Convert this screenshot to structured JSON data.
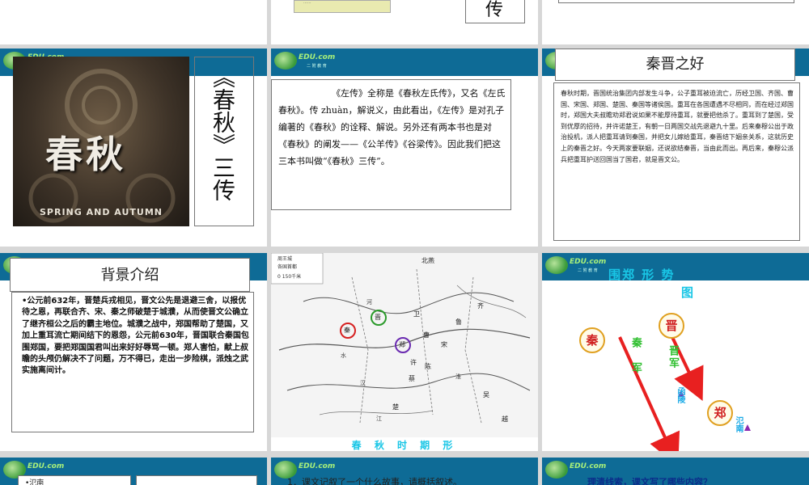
{
  "logo": {
    "text": "EDU.com",
    "sub": "二 附 教 育"
  },
  "row0": {
    "s2_char": "传"
  },
  "s4": {
    "image_title": "春秋",
    "image_subtitle": "SPRING AND AUTUMN",
    "vertical_title": "《春秋》三传"
  },
  "s5": {
    "text": "《左传》全称是《春秋左氏传》，又名《左氏春秋》。传 zhuàn，解说义，由此看出，《左传》是对孔子编著的《春秋》的诠释、解说。另外还有两本书也是对《春秋》的阐发——《公羊传》《谷梁传》。因此我们把这三本书叫做“《春秋》三传”。"
  },
  "s6": {
    "title": "秦晋之好",
    "text": "春秋时期，晋国统治集团内部发生斗争，公子重耳被迫流亡，历经卫国、齐国、曹国、宋国、郑国、楚国、秦国等诸侯国。重耳在各国遭遇不尽相同，而在经过郑国时，郑国大夫叔瞻劝郑君说如果不能厚待重耳，就要把他杀了。重耳到了楚国，受到优厚的招待，并许诺楚王，有朝一日两国交战先退避九十里。后来秦穆公出于政治投机，派人把重耳请到秦国，并把女儿嫁给重耳，秦晋结下姻亲关系，这就历史上的秦晋之好。今天两家要联姻，还说欲结秦晋，当由此而出。再后来，秦穆公派兵把重耳护送回国当了国君，就是晋文公。"
  },
  "s7": {
    "title": "背景介绍",
    "text": "•公元前632年，晋楚兵戎相见，晋文公先是退避三舍，以报优待之恩，再联合齐、宋、秦之师破楚于城濮，从而使晋文公确立了继齐桓公之后的霸主地位。城濮之战中，郑国帮助了楚国，又加上重耳流亡期间结下的恩怨，公元前630年，晋国联合秦国包围郑国，要把郑国国君叫出来好好辱骂一顿。郑人害怕，献上叔瞻的头颅仍解决不了问题，万不得已，走出一步险棋，派烛之武实施离间计。"
  },
  "s8": {
    "legend": [
      "周王城",
      "各国首都"
    ],
    "scale": "0 150千米",
    "caption": "春 秋 时 期 形",
    "states": [
      "北燕",
      "秦",
      "晋",
      "郑",
      "齐",
      "鲁",
      "宋",
      "卫",
      "曹",
      "陈",
      "蔡",
      "楚",
      "吴",
      "越",
      "许"
    ],
    "rivers": [
      "河",
      "水",
      "江",
      "淮",
      "汉"
    ]
  },
  "s9": {
    "title": "围郑 形 势",
    "title2": "图",
    "qin": "秦",
    "jin": "晋",
    "zheng": "郑",
    "qin_army": "秦军",
    "jin_army": "晋军",
    "hanling": "函陵",
    "fannan": "氾南"
  },
  "row3": {
    "s10_item": "•氾南",
    "s11_text": "1．课文记叙了一个什么故事，请概括叙述。",
    "s12_text": "理清线索，课文写了哪些内容？"
  },
  "colors": {
    "bar": "#0e6b96",
    "accent_red": "#d62020",
    "green": "#2fbf2f",
    "cyan": "#19c6e6"
  }
}
